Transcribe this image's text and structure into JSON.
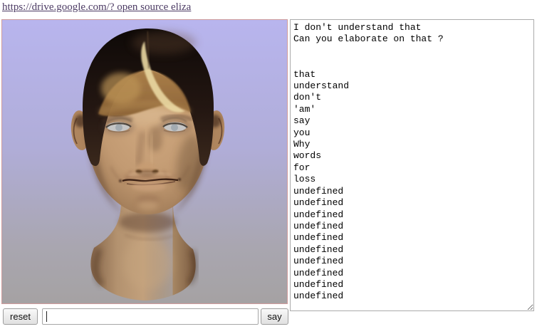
{
  "header": {
    "link_text": "https://drive.google.com/? open source eliza"
  },
  "avatar": {
    "alt": "3D rendered female head with brown hair and blonde streak on lavender gradient background"
  },
  "transcript": {
    "lines": [
      "I don't understand that",
      "Can you elaborate on that ?",
      "",
      "",
      "that",
      "understand",
      "don't",
      "'am'",
      "say",
      "you",
      "Why",
      "words",
      "for",
      "loss",
      "undefined",
      "undefined",
      "undefined",
      "undefined",
      "undefined",
      "undefined",
      "undefined",
      "undefined",
      "undefined",
      "undefined"
    ]
  },
  "controls": {
    "reset_label": "reset",
    "say_label": "say",
    "input_value": "",
    "input_placeholder": ""
  },
  "colors": {
    "link": "#4b3a63",
    "canvas_border": "#d09c9c",
    "canvas_bg_top": "#b8b5ee",
    "canvas_bg_bottom": "#a5a2a3",
    "skin": "#c49a72",
    "hair": "#1f1410",
    "hair_highlight": "#ead8a2"
  }
}
